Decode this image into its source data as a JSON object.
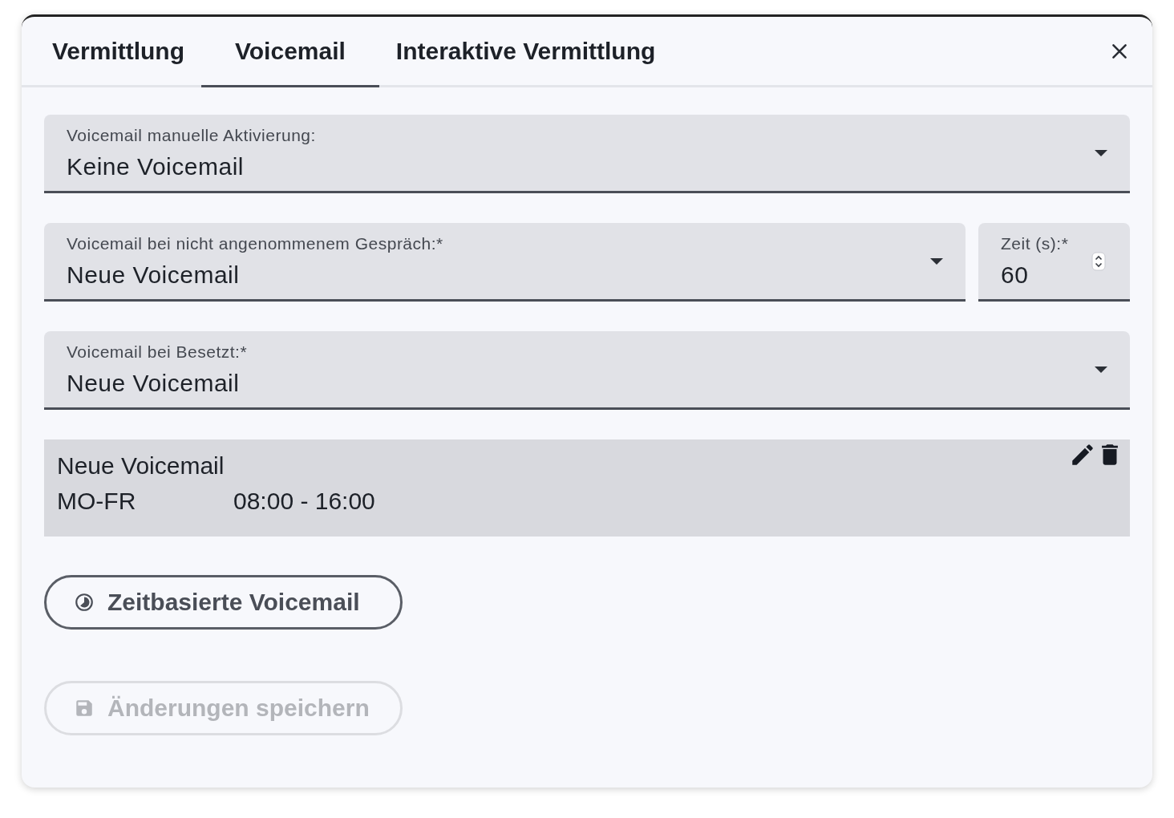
{
  "tabs": [
    {
      "label": "Vermittlung",
      "selected": false
    },
    {
      "label": "Voicemail",
      "selected": true
    },
    {
      "label": "Interaktive Vermittlung",
      "selected": false
    }
  ],
  "form_rows": [
    {
      "fields": [
        {
          "kind": "select",
          "label": "Voicemail manuelle Aktivierung:",
          "value": "Keine Voicemail"
        }
      ]
    },
    {
      "fields": [
        {
          "kind": "select",
          "label": "Voicemail bei nicht angenommenem Gespräch:*",
          "value": "Neue Voicemail"
        },
        {
          "kind": "number",
          "label": "Zeit (s):*",
          "value": "60"
        }
      ]
    },
    {
      "fields": [
        {
          "kind": "select",
          "label": "Voicemail bei Besetzt:*",
          "value": "Neue Voicemail"
        }
      ]
    }
  ],
  "schedule_card": {
    "title": "Neue Voicemail",
    "days": "MO-FR",
    "hours": "08:00 - 16:00"
  },
  "buttons": [
    {
      "kind": "clock",
      "label": "Zeitbasierte Voicemail",
      "disabled": false
    },
    {
      "kind": "save",
      "label": "Änderungen speichern",
      "disabled": true
    }
  ]
}
